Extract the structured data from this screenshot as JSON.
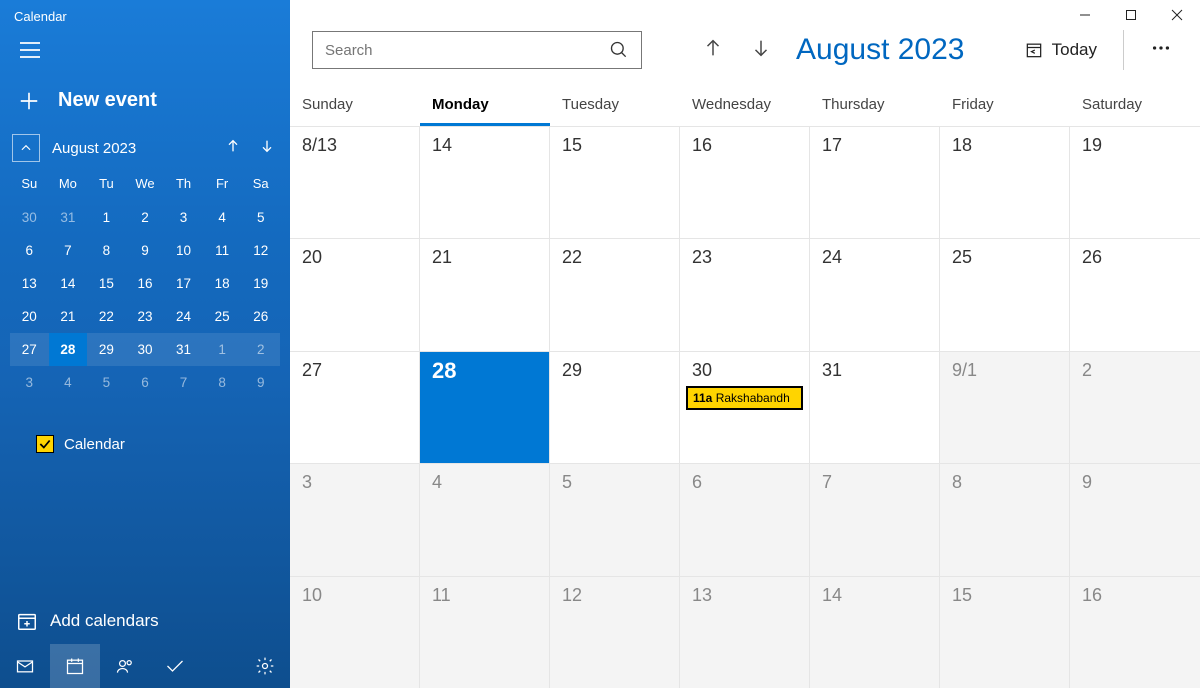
{
  "app_title": "Calendar",
  "sidebar": {
    "new_event": "New event",
    "mini_month_label": "August 2023",
    "mini_days": [
      "Su",
      "Mo",
      "Tu",
      "We",
      "Th",
      "Fr",
      "Sa"
    ],
    "mini_weeks": [
      [
        {
          "n": "30",
          "dim": true
        },
        {
          "n": "31",
          "dim": true
        },
        {
          "n": "1"
        },
        {
          "n": "2"
        },
        {
          "n": "3"
        },
        {
          "n": "4"
        },
        {
          "n": "5"
        }
      ],
      [
        {
          "n": "6"
        },
        {
          "n": "7"
        },
        {
          "n": "8"
        },
        {
          "n": "9"
        },
        {
          "n": "10"
        },
        {
          "n": "11"
        },
        {
          "n": "12"
        }
      ],
      [
        {
          "n": "13"
        },
        {
          "n": "14"
        },
        {
          "n": "15"
        },
        {
          "n": "16"
        },
        {
          "n": "17"
        },
        {
          "n": "18"
        },
        {
          "n": "19"
        }
      ],
      [
        {
          "n": "20"
        },
        {
          "n": "21"
        },
        {
          "n": "22"
        },
        {
          "n": "23"
        },
        {
          "n": "24"
        },
        {
          "n": "25"
        },
        {
          "n": "26"
        }
      ],
      [
        {
          "n": "27"
        },
        {
          "n": "28",
          "today": true
        },
        {
          "n": "29"
        },
        {
          "n": "30"
        },
        {
          "n": "31"
        },
        {
          "n": "1",
          "dim": true
        },
        {
          "n": "2",
          "dim": true
        }
      ],
      [
        {
          "n": "3",
          "dim": true
        },
        {
          "n": "4",
          "dim": true
        },
        {
          "n": "5",
          "dim": true
        },
        {
          "n": "6",
          "dim": true
        },
        {
          "n": "7",
          "dim": true
        },
        {
          "n": "8",
          "dim": true
        },
        {
          "n": "9",
          "dim": true
        }
      ]
    ],
    "selected_week_index": 4,
    "calendar_check_label": "Calendar",
    "add_calendars": "Add calendars"
  },
  "search_placeholder": "Search",
  "month_title": "August 2023",
  "today_label": "Today",
  "day_headers": [
    "Sunday",
    "Monday",
    "Tuesday",
    "Wednesday",
    "Thursday",
    "Friday",
    "Saturday"
  ],
  "active_day_header_index": 1,
  "weeks": [
    [
      {
        "l": "8/13"
      },
      {
        "l": "14"
      },
      {
        "l": "15"
      },
      {
        "l": "16"
      },
      {
        "l": "17"
      },
      {
        "l": "18"
      },
      {
        "l": "19"
      }
    ],
    [
      {
        "l": "20"
      },
      {
        "l": "21"
      },
      {
        "l": "22"
      },
      {
        "l": "23"
      },
      {
        "l": "24"
      },
      {
        "l": "25"
      },
      {
        "l": "26"
      }
    ],
    [
      {
        "l": "27"
      },
      {
        "l": "28",
        "selected": true
      },
      {
        "l": "29"
      },
      {
        "l": "30",
        "event": {
          "time": "11a",
          "title": "Rakshabandh"
        }
      },
      {
        "l": "31"
      },
      {
        "l": "9/1",
        "shade": true
      },
      {
        "l": "2",
        "shade": true
      }
    ],
    [
      {
        "l": "3",
        "shade": true
      },
      {
        "l": "4",
        "shade": true
      },
      {
        "l": "5",
        "shade": true
      },
      {
        "l": "6",
        "shade": true
      },
      {
        "l": "7",
        "shade": true
      },
      {
        "l": "8",
        "shade": true
      },
      {
        "l": "9",
        "shade": true
      }
    ],
    [
      {
        "l": "10",
        "shade": true
      },
      {
        "l": "11",
        "shade": true
      },
      {
        "l": "12",
        "shade": true
      },
      {
        "l": "13",
        "shade": true
      },
      {
        "l": "14",
        "shade": true
      },
      {
        "l": "15",
        "shade": true
      },
      {
        "l": "16",
        "shade": true
      }
    ]
  ]
}
